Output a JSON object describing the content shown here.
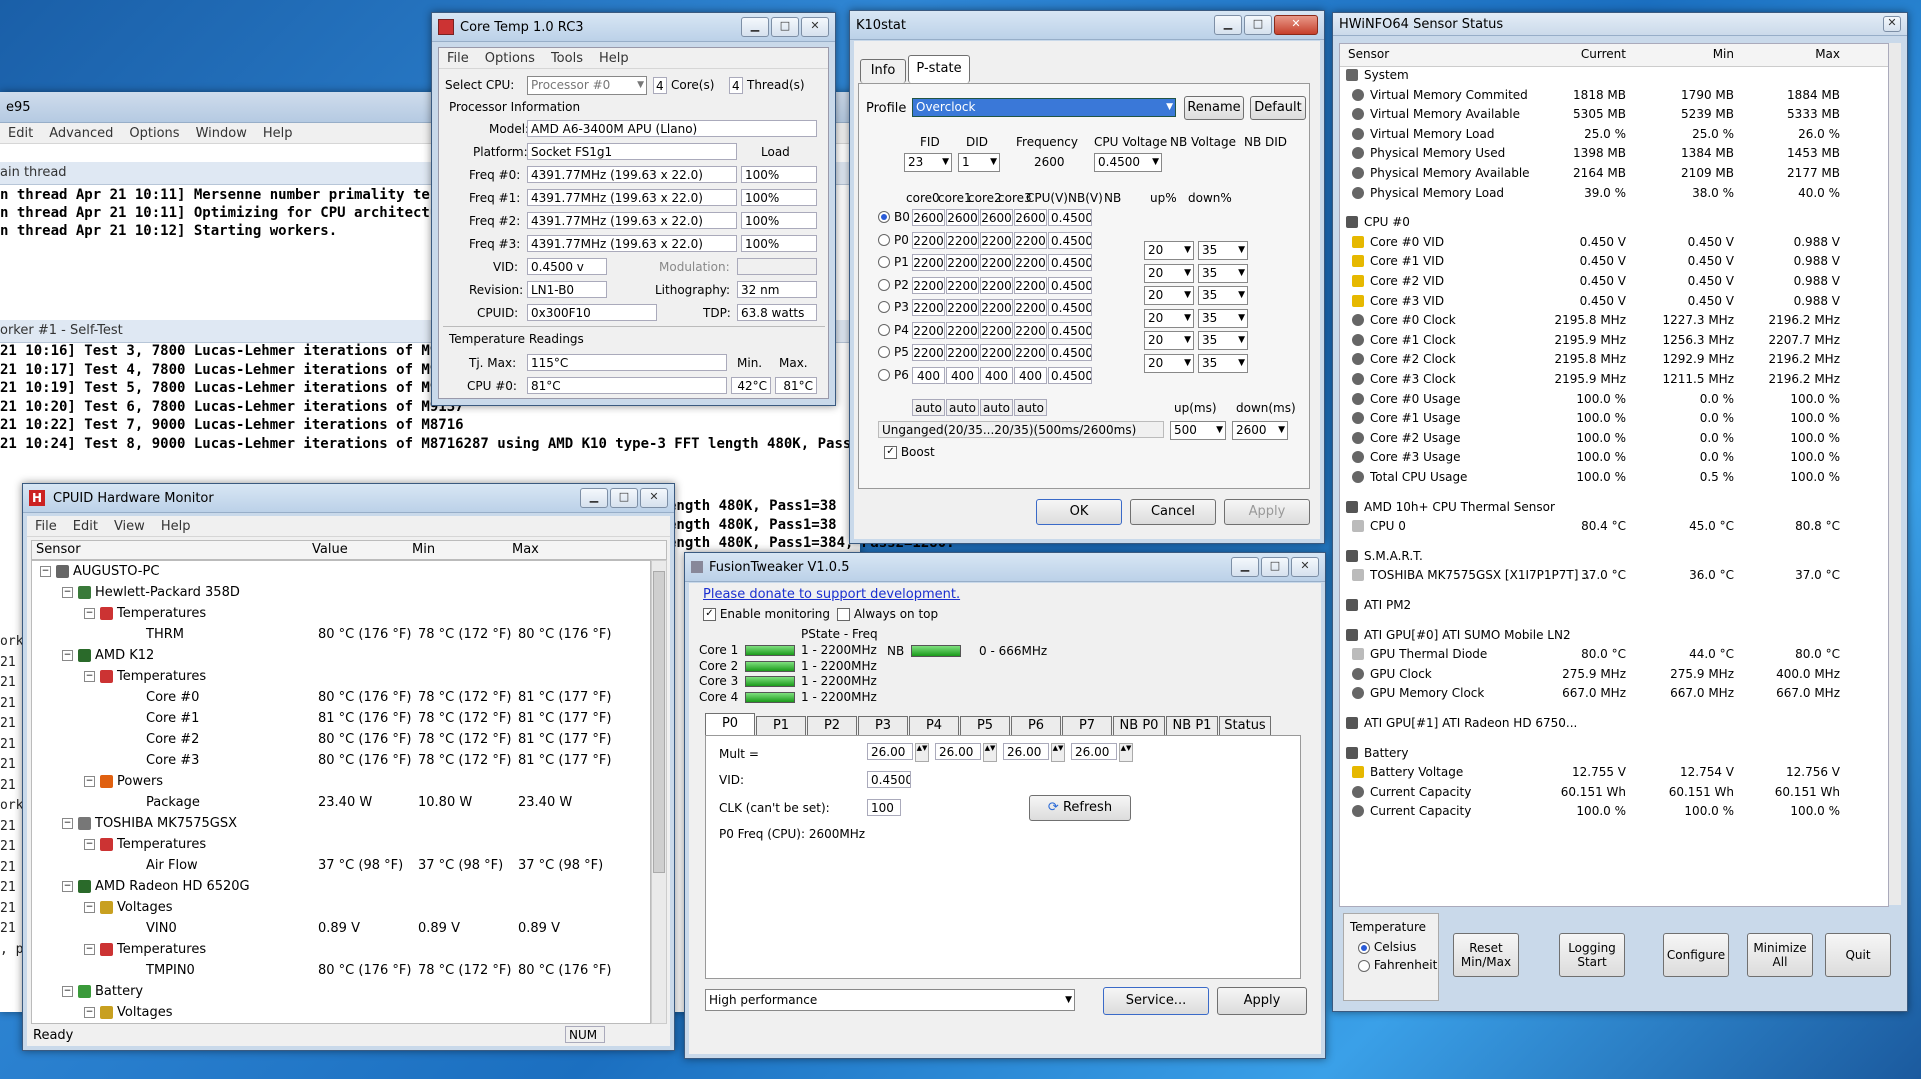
{
  "prime95": {
    "title": "e95",
    "menu": [
      "Edit",
      "Advanced",
      "Options",
      "Window",
      "Help"
    ],
    "main_thread_label": "ain thread",
    "main_lines": [
      "n thread Apr 21 10:11] Mersenne number primality test pr",
      "n thread Apr 21 10:11] Optimizing for CPU architecture: AM",
      "n thread Apr 21 10:12] Starting workers."
    ],
    "worker1_label": "orker #1 - Self-Test",
    "worker1_lines": [
      "21 10:16] Test 3, 7800 Lucas-Lehmer iterations of M9437",
      "21 10:17] Test 4, 7800 Lucas-Lehmer iterations of M9337",
      "21 10:19] Test 5, 7800 Lucas-Lehmer iterations of M9237",
      "21 10:20] Test 6, 7800 Lucas-Lehmer iterations of M9137",
      "21 10:22] Test 7, 9000 Lucas-Lehmer iterations of M8716",
      "21 10:24] Test 8, 9000 Lucas-Lehmer iterations of M8716287 using AMD K10 type-3 FFT length 480K, Pass1=384"
    ],
    "side_lines": [
      "ength 480K, Pass1=38",
      "ength 480K, Pass1=38",
      "ength 480K, Pass1=384, Pass2=1280."
    ],
    "left_fragments": [
      "orke",
      "21",
      "21",
      "21",
      "21",
      "21",
      "21",
      "21",
      "orke",
      "21",
      "21",
      "21",
      "21",
      "21",
      "21",
      ", pr"
    ]
  },
  "coretemp": {
    "title": "Core Temp 1.0 RC3",
    "menu": [
      "File",
      "Options",
      "Tools",
      "Help"
    ],
    "select_cpu_label": "Select CPU:",
    "processor": "Processor #0",
    "cores": "4",
    "cores_label": "Core(s)",
    "threads": "4",
    "threads_label": "Thread(s)",
    "proc_info_label": "Processor Information",
    "model_label": "Model:",
    "model": "AMD A6-3400M APU (Llano)",
    "platform_label": "Platform:",
    "platform": "Socket FS1g1",
    "load_label": "Load",
    "freqs": [
      {
        "label": "Freq #0:",
        "value": "4391.77MHz (199.63 x 22.0)",
        "load": "100%"
      },
      {
        "label": "Freq #1:",
        "value": "4391.77MHz (199.63 x 22.0)",
        "load": "100%"
      },
      {
        "label": "Freq #2:",
        "value": "4391.77MHz (199.63 x 22.0)",
        "load": "100%"
      },
      {
        "label": "Freq #3:",
        "value": "4391.77MHz (199.63 x 22.0)",
        "load": "100%"
      }
    ],
    "vid_label": "VID:",
    "vid": "0.4500 v",
    "modulation_label": "Modulation:",
    "revision_label": "Revision:",
    "revision": "LN1-B0",
    "litho_label": "Lithography:",
    "litho": "32 nm",
    "cpuid_label": "CPUID:",
    "cpuid": "0x300F10",
    "tdp_label": "TDP:",
    "tdp": "63.8 watts",
    "temp_label": "Temperature Readings",
    "tjmax_label": "Tj. Max:",
    "tjmax": "115°C",
    "min_label": "Min.",
    "max_label": "Max.",
    "cpu0_label": "CPU #0:",
    "cpu0": "81°C",
    "cpu0_min": "42°C",
    "cpu0_max": "81°C"
  },
  "k10": {
    "title": "K10stat",
    "tabs": [
      "Info",
      "P-state"
    ],
    "profile_label": "Profile",
    "profile": "Overclock",
    "rename": "Rename",
    "default": "Default",
    "fid_label": "FID",
    "did_label": "DID",
    "freq_label": "Frequency",
    "cpuv_label": "CPU Voltage",
    "nbv_label": "NB Voltage",
    "nbdid_label": "NB DID",
    "fid": "23",
    "did": "1",
    "freq": "2600",
    "cpuv": "0.4500",
    "col_headers": [
      "core0",
      "core1",
      "core2",
      "core3",
      "CPU(V)",
      "NB(V)",
      "NB",
      "up%",
      "down%"
    ],
    "rows": [
      {
        "name": "B0",
        "vals": [
          "2600",
          "2600",
          "2600",
          "2600"
        ],
        "v": "0.4500"
      },
      {
        "name": "P0",
        "vals": [
          "2200",
          "2200",
          "2200",
          "2200"
        ],
        "v": "0.4500"
      },
      {
        "name": "P1",
        "vals": [
          "2200",
          "2200",
          "2200",
          "2200"
        ],
        "v": "0.4500"
      },
      {
        "name": "P2",
        "vals": [
          "2200",
          "2200",
          "2200",
          "2200"
        ],
        "v": "0.4500"
      },
      {
        "name": "P3",
        "vals": [
          "2200",
          "2200",
          "2200",
          "2200"
        ],
        "v": "0.4500"
      },
      {
        "name": "P4",
        "vals": [
          "2200",
          "2200",
          "2200",
          "2200"
        ],
        "v": "0.4500"
      },
      {
        "name": "P5",
        "vals": [
          "2200",
          "2200",
          "2200",
          "2200"
        ],
        "v": "0.4500"
      },
      {
        "name": "P6",
        "vals": [
          "400",
          "400",
          "400",
          "400"
        ],
        "v": "0.4500"
      }
    ],
    "updown": [
      [
        "20",
        "35"
      ],
      [
        "20",
        "35"
      ],
      [
        "20",
        "35"
      ],
      [
        "20",
        "35"
      ],
      [
        "20",
        "35"
      ],
      [
        "20",
        "35"
      ]
    ],
    "auto": "auto",
    "upms_label": "up(ms)",
    "downms_label": "down(ms)",
    "unganged": "Unganged(20/35...20/35)(500ms/2600ms)",
    "upms": "500",
    "downms": "2600",
    "boost": "Boost",
    "ok": "OK",
    "cancel": "Cancel",
    "apply": "Apply"
  },
  "cpuid": {
    "title": "CPUID Hardware Monitor",
    "menu": [
      "File",
      "Edit",
      "View",
      "Help"
    ],
    "cols": [
      "Sensor",
      "Value",
      "Min",
      "Max"
    ],
    "rows": [
      {
        "lvl": 0,
        "icon": "computer-icon",
        "text": "AUGUSTO-PC",
        "v": "",
        "mi": "",
        "ma": ""
      },
      {
        "lvl": 1,
        "icon": "motherboard-icon",
        "text": "Hewlett-Packard 358D",
        "v": "",
        "mi": "",
        "ma": ""
      },
      {
        "lvl": 2,
        "icon": "thermometer-icon",
        "text": "Temperatures",
        "v": "",
        "mi": "",
        "ma": ""
      },
      {
        "lvl": 3,
        "icon": "",
        "text": "THRM",
        "v": "80 °C  (176 °F)",
        "mi": "78 °C  (172 °F)",
        "ma": "80 °C  (176 °F)"
      },
      {
        "lvl": 1,
        "icon": "chip-icon",
        "text": "AMD K12",
        "v": "",
        "mi": "",
        "ma": ""
      },
      {
        "lvl": 2,
        "icon": "thermometer-icon",
        "text": "Temperatures",
        "v": "",
        "mi": "",
        "ma": ""
      },
      {
        "lvl": 3,
        "icon": "",
        "text": "Core #0",
        "v": "80 °C  (176 °F)",
        "mi": "78 °C  (172 °F)",
        "ma": "81 °C  (177 °F)"
      },
      {
        "lvl": 3,
        "icon": "",
        "text": "Core #1",
        "v": "81 °C  (176 °F)",
        "mi": "78 °C  (172 °F)",
        "ma": "81 °C  (177 °F)"
      },
      {
        "lvl": 3,
        "icon": "",
        "text": "Core #2",
        "v": "80 °C  (176 °F)",
        "mi": "78 °C  (172 °F)",
        "ma": "81 °C  (177 °F)"
      },
      {
        "lvl": 3,
        "icon": "",
        "text": "Core #3",
        "v": "80 °C  (176 °F)",
        "mi": "78 °C  (172 °F)",
        "ma": "81 °C  (177 °F)"
      },
      {
        "lvl": 2,
        "icon": "fire-icon",
        "text": "Powers",
        "v": "",
        "mi": "",
        "ma": ""
      },
      {
        "lvl": 3,
        "icon": "",
        "text": "Package",
        "v": "23.40 W",
        "mi": "10.80 W",
        "ma": "23.40 W"
      },
      {
        "lvl": 1,
        "icon": "harddisk-icon",
        "text": "TOSHIBA MK7575GSX",
        "v": "",
        "mi": "",
        "ma": ""
      },
      {
        "lvl": 2,
        "icon": "thermometer-icon",
        "text": "Temperatures",
        "v": "",
        "mi": "",
        "ma": ""
      },
      {
        "lvl": 3,
        "icon": "",
        "text": "Air Flow",
        "v": "37 °C  (98 °F)",
        "mi": "37 °C  (98 °F)",
        "ma": "37 °C  (98 °F)"
      },
      {
        "lvl": 1,
        "icon": "gpu-icon",
        "text": "AMD Radeon HD 6520G",
        "v": "",
        "mi": "",
        "ma": ""
      },
      {
        "lvl": 2,
        "icon": "voltage-icon",
        "text": "Voltages",
        "v": "",
        "mi": "",
        "ma": ""
      },
      {
        "lvl": 3,
        "icon": "",
        "text": "VIN0",
        "v": "0.89 V",
        "mi": "0.89 V",
        "ma": "0.89 V"
      },
      {
        "lvl": 2,
        "icon": "thermometer-icon",
        "text": "Temperatures",
        "v": "",
        "mi": "",
        "ma": ""
      },
      {
        "lvl": 3,
        "icon": "",
        "text": "TMPIN0",
        "v": "80 °C  (176 °F)",
        "mi": "78 °C  (172 °F)",
        "ma": "80 °C  (176 °F)"
      },
      {
        "lvl": 1,
        "icon": "battery-icon",
        "text": "Battery",
        "v": "",
        "mi": "",
        "ma": ""
      },
      {
        "lvl": 2,
        "icon": "voltage-icon",
        "text": "Voltages",
        "v": "",
        "mi": "",
        "ma": ""
      }
    ],
    "status": "Ready",
    "num": "NUM"
  },
  "fusion": {
    "title": "FusionTweaker V1.0.5",
    "donate": "Please donate to support development.",
    "enable": "Enable monitoring",
    "ontop": "Always on top",
    "pstate_label": "PState - Freq",
    "cores": [
      {
        "name": "Core 1",
        "val": "1 - 2200MHz"
      },
      {
        "name": "Core 2",
        "val": "1 - 2200MHz"
      },
      {
        "name": "Core 3",
        "val": "1 - 2200MHz"
      },
      {
        "name": "Core 4",
        "val": "1 - 2200MHz"
      }
    ],
    "nb_label": "NB",
    "nb_val": "0 - 666MHz",
    "tabs": [
      "P0",
      "P1",
      "P2",
      "P3",
      "P4",
      "P5",
      "P6",
      "P7",
      "NB P0",
      "NB P1",
      "Status"
    ],
    "mult_label": "Mult =",
    "mults": [
      "26.00",
      "26.00",
      "26.00",
      "26.00"
    ],
    "vid_label": "VID:",
    "vid": "0.4500",
    "clk_label": "CLK (can't be set):",
    "clk": "100",
    "refresh": "Refresh",
    "p0freq": "P0 Freq (CPU): 2600MHz",
    "plan": "High performance",
    "service": "Service...",
    "apply": "Apply"
  },
  "hwinfo": {
    "title": "HWiNFO64 Sensor Status",
    "cols": [
      "Sensor",
      "Current",
      "Min",
      "Max"
    ],
    "rows": [
      {
        "t": "h",
        "icon": "system-icon",
        "name": "System"
      },
      {
        "t": "r",
        "icon": "gauge-icon",
        "name": "Virtual Memory Commited",
        "c": "1818 MB",
        "mi": "1790 MB",
        "ma": "1884 MB"
      },
      {
        "t": "r",
        "icon": "gauge-icon",
        "name": "Virtual Memory Available",
        "c": "5305 MB",
        "mi": "5239 MB",
        "ma": "5333 MB"
      },
      {
        "t": "r",
        "icon": "gauge-icon",
        "name": "Virtual Memory Load",
        "c": "25.0 %",
        "mi": "25.0 %",
        "ma": "26.0 %"
      },
      {
        "t": "r",
        "icon": "gauge-icon",
        "name": "Physical Memory Used",
        "c": "1398 MB",
        "mi": "1384 MB",
        "ma": "1453 MB"
      },
      {
        "t": "r",
        "icon": "gauge-icon",
        "name": "Physical Memory Available",
        "c": "2164 MB",
        "mi": "2109 MB",
        "ma": "2177 MB"
      },
      {
        "t": "r",
        "icon": "gauge-icon",
        "name": "Physical Memory Load",
        "c": "39.0 %",
        "mi": "38.0 %",
        "ma": "40.0 %"
      },
      {
        "t": "s"
      },
      {
        "t": "h",
        "icon": "cpu-icon",
        "name": "CPU #0"
      },
      {
        "t": "r",
        "icon": "bolt-icon",
        "name": "Core #0 VID",
        "c": "0.450 V",
        "mi": "0.450 V",
        "ma": "0.988 V"
      },
      {
        "t": "r",
        "icon": "bolt-icon",
        "name": "Core #1 VID",
        "c": "0.450 V",
        "mi": "0.450 V",
        "ma": "0.988 V"
      },
      {
        "t": "r",
        "icon": "bolt-icon",
        "name": "Core #2 VID",
        "c": "0.450 V",
        "mi": "0.450 V",
        "ma": "0.988 V"
      },
      {
        "t": "r",
        "icon": "bolt-icon",
        "name": "Core #3 VID",
        "c": "0.450 V",
        "mi": "0.450 V",
        "ma": "0.988 V"
      },
      {
        "t": "r",
        "icon": "gauge-icon",
        "name": "Core #0 Clock",
        "c": "2195.8 MHz",
        "mi": "1227.3 MHz",
        "ma": "2196.2 MHz"
      },
      {
        "t": "r",
        "icon": "gauge-icon",
        "name": "Core #1 Clock",
        "c": "2195.9 MHz",
        "mi": "1256.3 MHz",
        "ma": "2207.7 MHz"
      },
      {
        "t": "r",
        "icon": "gauge-icon",
        "name": "Core #2 Clock",
        "c": "2195.8 MHz",
        "mi": "1292.9 MHz",
        "ma": "2196.2 MHz"
      },
      {
        "t": "r",
        "icon": "gauge-icon",
        "name": "Core #3 Clock",
        "c": "2195.9 MHz",
        "mi": "1211.5 MHz",
        "ma": "2196.2 MHz"
      },
      {
        "t": "r",
        "icon": "gauge-icon",
        "name": "Core #0 Usage",
        "c": "100.0 %",
        "mi": "0.0 %",
        "ma": "100.0 %"
      },
      {
        "t": "r",
        "icon": "gauge-icon",
        "name": "Core #1 Usage",
        "c": "100.0 %",
        "mi": "0.0 %",
        "ma": "100.0 %"
      },
      {
        "t": "r",
        "icon": "gauge-icon",
        "name": "Core #2 Usage",
        "c": "100.0 %",
        "mi": "0.0 %",
        "ma": "100.0 %"
      },
      {
        "t": "r",
        "icon": "gauge-icon",
        "name": "Core #3 Usage",
        "c": "100.0 %",
        "mi": "0.0 %",
        "ma": "100.0 %"
      },
      {
        "t": "r",
        "icon": "gauge-icon",
        "name": "Total CPU Usage",
        "c": "100.0 %",
        "mi": "0.5 %",
        "ma": "100.0 %"
      },
      {
        "t": "s"
      },
      {
        "t": "h",
        "icon": "cpu-icon",
        "name": "AMD 10h+ CPU Thermal Sensor"
      },
      {
        "t": "r",
        "icon": "thermometer-icon",
        "name": "CPU 0",
        "c": "80.4 °C",
        "mi": "45.0 °C",
        "ma": "80.8 °C"
      },
      {
        "t": "s"
      },
      {
        "t": "h",
        "icon": "cpu-icon",
        "name": "S.M.A.R.T."
      },
      {
        "t": "r",
        "icon": "thermometer-icon",
        "name": "TOSHIBA MK7575GSX [X1I7P1P7T] ...",
        "c": "37.0 °C",
        "mi": "36.0 °C",
        "ma": "37.0 °C"
      },
      {
        "t": "s"
      },
      {
        "t": "h",
        "icon": "cpu-icon",
        "name": "ATI PM2"
      },
      {
        "t": "s"
      },
      {
        "t": "h",
        "icon": "cpu-icon",
        "name": "ATI GPU[#0] ATI SUMO Mobile LN2"
      },
      {
        "t": "r",
        "icon": "thermometer-icon",
        "name": "GPU Thermal Diode",
        "c": "80.0 °C",
        "mi": "44.0 °C",
        "ma": "80.0 °C"
      },
      {
        "t": "r",
        "icon": "gauge-icon",
        "name": "GPU Clock",
        "c": "275.9 MHz",
        "mi": "275.9 MHz",
        "ma": "400.0 MHz"
      },
      {
        "t": "r",
        "icon": "gauge-icon",
        "name": "GPU Memory Clock",
        "c": "667.0 MHz",
        "mi": "667.0 MHz",
        "ma": "667.0 MHz"
      },
      {
        "t": "s"
      },
      {
        "t": "h",
        "icon": "cpu-icon",
        "name": "ATI GPU[#1] ATI Radeon HD 6750..."
      },
      {
        "t": "s"
      },
      {
        "t": "h",
        "icon": "battery-icon",
        "name": "Battery"
      },
      {
        "t": "r",
        "icon": "bolt-icon",
        "name": "Battery Voltage",
        "c": "12.755 V",
        "mi": "12.754 V",
        "ma": "12.756 V"
      },
      {
        "t": "r",
        "icon": "gauge-icon",
        "name": "Current Capacity",
        "c": "60.151 Wh",
        "mi": "60.151 Wh",
        "ma": "60.151 Wh"
      },
      {
        "t": "r",
        "icon": "gauge-icon",
        "name": "Current Capacity",
        "c": "100.0 %",
        "mi": "100.0 %",
        "ma": "100.0 %"
      }
    ],
    "temp_label": "Temperature",
    "celsius": "Celsius",
    "fahrenheit": "Fahrenheit",
    "buttons": [
      "Reset Min/Max",
      "Logging Start",
      "Configure",
      "Minimize All",
      "Quit"
    ]
  }
}
